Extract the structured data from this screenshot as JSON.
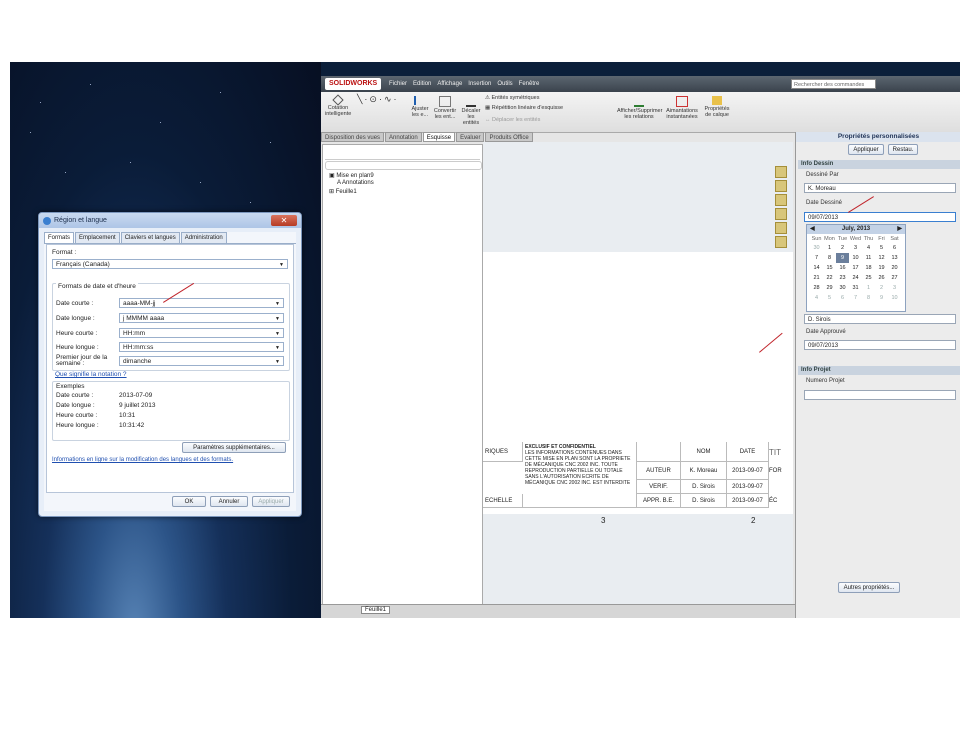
{
  "dialog": {
    "title": "Région et langue",
    "tabs": [
      "Formats",
      "Emplacement",
      "Claviers et langues",
      "Administration"
    ],
    "format_label": "Format :",
    "format_value": "Français (Canada)",
    "group_label": "Formats de date et d'heure",
    "rows": [
      {
        "label": "Date courte :",
        "value": "aaaa-MM-jj"
      },
      {
        "label": "Date longue :",
        "value": "j MMMM aaaa"
      },
      {
        "label": "Heure courte :",
        "value": "HH:mm"
      },
      {
        "label": "Heure longue :",
        "value": "HH:mm:ss"
      },
      {
        "label": "Premier jour de la semaine :",
        "value": "dimanche"
      }
    ],
    "notation_link": "Que signifie la notation ?",
    "examples_label": "Exemples",
    "examples": [
      {
        "label": "Date courte :",
        "value": "2013-07-09"
      },
      {
        "label": "Date longue :",
        "value": "9 juillet 2013"
      },
      {
        "label": "Heure courte :",
        "value": "10:31"
      },
      {
        "label": "Heure longue :",
        "value": "10:31:42"
      }
    ],
    "more_button": "Paramètres supplémentaires...",
    "info_link": "Informations en ligne sur la modification des langues et des formats.",
    "ok": "OK",
    "cancel": "Annuler",
    "apply": "Appliquer"
  },
  "sw": {
    "logo": "SOLIDWORKS",
    "menus": [
      "Fichier",
      "Edition",
      "Affichage",
      "Insertion",
      "Outils",
      "Fenêtre"
    ],
    "search_placeholder": "Rechercher des commandes",
    "ribbon": {
      "cotation": "Cotation intelligente",
      "ajuster": "Ajuster les e...",
      "convertir": "Convertir les ent...",
      "decaler": "Décaler les entités",
      "symetriques": "Entités symétriques",
      "repetition": "Répétition linéaire d'esquisse",
      "deplacer": "Déplacer les entités",
      "relations": "Afficher/Supprimer les relations",
      "aimantations": "Aimantations instantanées",
      "calque": "Propriétés de calque"
    },
    "cmtabs": [
      "Disposition des vues",
      "Annotation",
      "Esquisse",
      "Evaluer",
      "Produits Office"
    ],
    "tree": [
      "Mise en plan9",
      "Annotations",
      "Feuille1"
    ],
    "sheet_tab": "Feuille1",
    "titleblock": {
      "left_col": "RIQUES",
      "left_col2": "ECHELLE",
      "notice_title": "EXCLUSIF ET CONFIDENTIEL",
      "notice": "LES INFORMATIONS CONTENUES DANS CETTE MISE EN PLAN SONT LA PROPRIETE DE MÉCANIQUE CNC 2002 INC. TOUTE REPRODUCTION PARTIELLE OU TOTALE SANS L'AUTORISATION ECRITE DE MÉCANIQUE CNC 2002 INC. EST INTERDITE",
      "h_nom": "NOM",
      "h_date": "DATE",
      "rows": [
        {
          "role": "AUTEUR",
          "name": "K. Moreau",
          "date": "2013-09-07"
        },
        {
          "role": "VERIF.",
          "name": "D. Sirois",
          "date": "2013-09-07"
        },
        {
          "role": "APPR. B.E.",
          "name": "D. Sirois",
          "date": "2013-09-07"
        }
      ],
      "zone3": "3",
      "zone2": "2",
      "edge1": "FOR",
      "edge2": "ÉC",
      "edge3": "TIT"
    },
    "props": {
      "title": "Propriétés personnalisées",
      "apply": "Appliquer",
      "restore": "Restau.",
      "info_dessin": "Info Dessin",
      "dessine_par_label": "Dessiné Par",
      "dessine_par": "K. Moreau",
      "date_dessine_label": "Date Dessiné",
      "date_dessine": "09/07/2013",
      "calendar_month": "July, 2013",
      "dow": [
        "Sun",
        "Mon",
        "Tue",
        "Wed",
        "Thu",
        "Fri",
        "Sat"
      ],
      "days": [
        "30",
        "1",
        "2",
        "3",
        "4",
        "5",
        "6",
        "7",
        "8",
        "9",
        "10",
        "11",
        "12",
        "13",
        "14",
        "15",
        "16",
        "17",
        "18",
        "19",
        "20",
        "21",
        "22",
        "23",
        "24",
        "25",
        "26",
        "27",
        "28",
        "29",
        "30",
        "31",
        "1",
        "2",
        "3",
        "4",
        "5",
        "6",
        "7",
        "8",
        "9",
        "10"
      ],
      "verif": "D. Sirois",
      "date_approuve_label": "Date Approuvé",
      "date_approuve": "09/07/2013",
      "info_projet": "Info Projet",
      "numero_projet_label": "Numero Projet",
      "autres": "Autres propriétés..."
    }
  },
  "colors": {
    "accent": "#c0242b",
    "selected_day": "#6b7f9c"
  }
}
